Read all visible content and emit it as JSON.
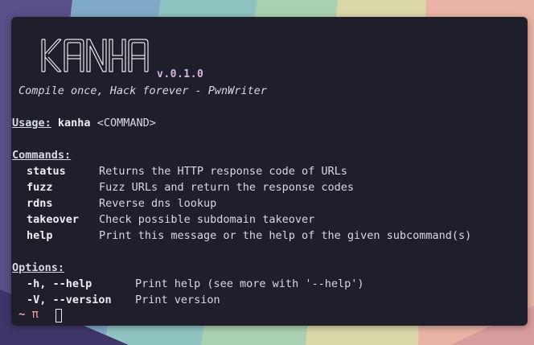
{
  "banner": {
    "logo_text": "KANHA",
    "version": "v.0.1.0",
    "tagline": "Compile once, Hack forever - PwnWriter"
  },
  "usage": {
    "label": "Usage:",
    "binary": "kanha",
    "arg": "<COMMAND>"
  },
  "commands": {
    "label": "Commands:",
    "items": [
      {
        "name": "status",
        "desc": "Returns the HTTP response code of URLs"
      },
      {
        "name": "fuzz",
        "desc": "Fuzz URLs and return the response codes"
      },
      {
        "name": "rdns",
        "desc": "Reverse dns lookup"
      },
      {
        "name": "takeover",
        "desc": "Check possible subdomain takeover"
      },
      {
        "name": "help",
        "desc": "Print this message or the help of the given subcommand(s)"
      }
    ]
  },
  "options": {
    "label": "Options:",
    "items": [
      {
        "flag": "-h, --help",
        "desc": "Print help (see more with '--help')"
      },
      {
        "flag": "-V, --version",
        "desc": "Print version"
      }
    ]
  },
  "prompt": {
    "tilde": "~",
    "symbol": "π"
  },
  "colors": {
    "terminal_bg": "#1f1f2b",
    "text": "#d7d8e6",
    "prompt_accent": "#f2a38c",
    "version_accent": "#d8b7e8"
  }
}
